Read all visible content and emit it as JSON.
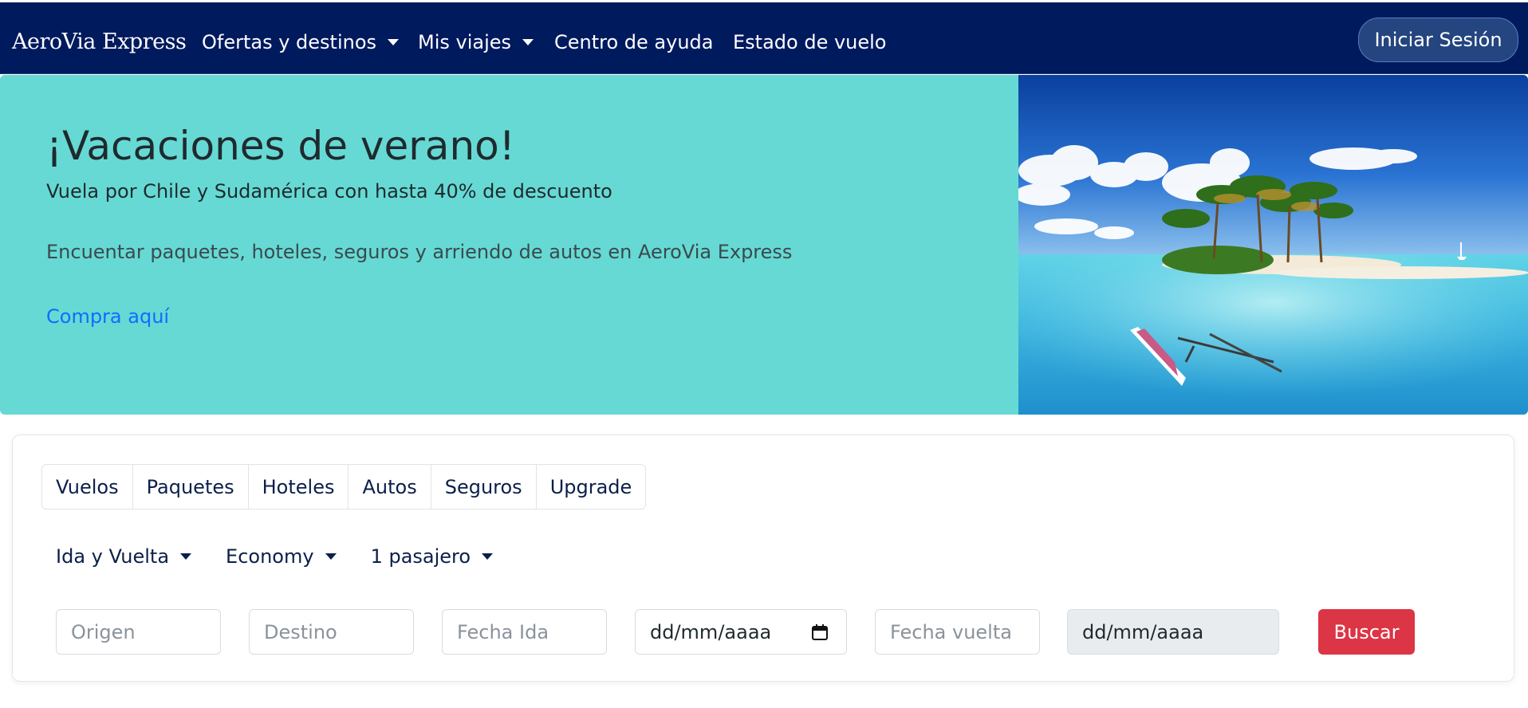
{
  "nav": {
    "brand": "AeroVia Express",
    "items": [
      {
        "label": "Ofertas y destinos",
        "dropdown": true
      },
      {
        "label": "Mis viajes",
        "dropdown": true
      },
      {
        "label": "Centro de ayuda",
        "dropdown": false
      },
      {
        "label": "Estado de vuelo",
        "dropdown": false
      }
    ],
    "login_label": "Iniciar Sesión"
  },
  "hero": {
    "title": "¡Vacaciones de verano!",
    "subtitle": "Vuela por Chile y Sudamérica con hasta 40% de descuento",
    "description": "Encuentar paquetes, hoteles, seguros y arriendo de autos en AeroVia Express",
    "link": "Compra aquí"
  },
  "search": {
    "tabs": [
      "Vuelos",
      "Paquetes",
      "Hoteles",
      "Autos",
      "Seguros",
      "Upgrade"
    ],
    "trip_type": "Ida y Vuelta",
    "cabin": "Economy",
    "passengers": "1 pasajero",
    "origin_placeholder": "Origen",
    "destination_placeholder": "Destino",
    "date_out_label": "Fecha Ida",
    "date_out_value": "dd/mm/aaaa",
    "date_back_label": "Fecha vuelta",
    "date_back_value": "dd/mm/aaaa",
    "submit_label": "Buscar"
  },
  "colors": {
    "navbar": "#001a5e",
    "hero_bg": "#66d9d4",
    "link": "#0d6efd",
    "buscar": "#dc3545",
    "login_btn": "#24457f"
  }
}
